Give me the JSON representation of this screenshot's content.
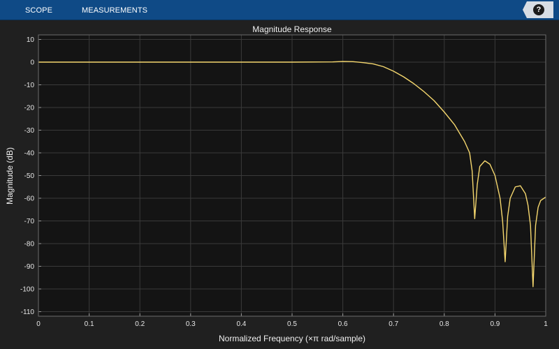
{
  "toolbar": {
    "tabs": [
      "SCOPE",
      "MEASUREMENTS"
    ],
    "help_label": "?"
  },
  "colors": {
    "toolbar_bg": "#0f4a86",
    "plot_bg": "#141414",
    "line": "#f5d76e",
    "grid": "#3a3a3a"
  },
  "chart_data": {
    "type": "line",
    "title": "Magnitude Response",
    "xlabel": "Normalized Frequency (×π rad/sample)",
    "ylabel": "Magnitude (dB)",
    "xlim": [
      0,
      1
    ],
    "ylim": [
      -112,
      12
    ],
    "grid": true,
    "xticks": [
      0,
      0.1,
      0.2,
      0.3,
      0.4,
      0.5,
      0.6,
      0.7,
      0.8,
      0.9,
      1
    ],
    "xtick_labels": [
      "0",
      "0.1",
      "0.2",
      "0.3",
      "0.4",
      "0.5",
      "0.6",
      "0.7",
      "0.8",
      "0.9",
      "1"
    ],
    "yticks": [
      10,
      0,
      -10,
      -20,
      -30,
      -40,
      -50,
      -60,
      -70,
      -80,
      -90,
      -100,
      -110
    ],
    "ytick_labels": [
      "10",
      "0",
      "-10",
      "-20",
      "-30",
      "-40",
      "-50",
      "-60",
      "-70",
      "-80",
      "-90",
      "-100",
      "-110"
    ],
    "series": [
      {
        "color": "#f5d76e",
        "x": [
          0,
          0.1,
          0.2,
          0.3,
          0.4,
          0.5,
          0.58,
          0.6,
          0.62,
          0.64,
          0.66,
          0.68,
          0.7,
          0.72,
          0.74,
          0.76,
          0.78,
          0.8,
          0.82,
          0.84,
          0.85,
          0.855,
          0.86,
          0.865,
          0.87,
          0.88,
          0.89,
          0.9,
          0.91,
          0.915,
          0.92,
          0.925,
          0.93,
          0.94,
          0.95,
          0.96,
          0.965,
          0.97,
          0.975,
          0.98,
          0.985,
          0.99,
          1.0
        ],
        "y": [
          0,
          0,
          0,
          0,
          0,
          0,
          0.1,
          0.3,
          0.2,
          -0.2,
          -0.8,
          -2,
          -4,
          -6.5,
          -9.5,
          -13,
          -17,
          -22,
          -27.5,
          -35,
          -40,
          -48,
          -69,
          -54,
          -46,
          -43.5,
          -45,
          -50,
          -60,
          -70,
          -88,
          -68,
          -60,
          -55,
          -54.5,
          -58,
          -63,
          -72,
          -99,
          -72,
          -64,
          -61,
          -59.5
        ]
      }
    ]
  }
}
